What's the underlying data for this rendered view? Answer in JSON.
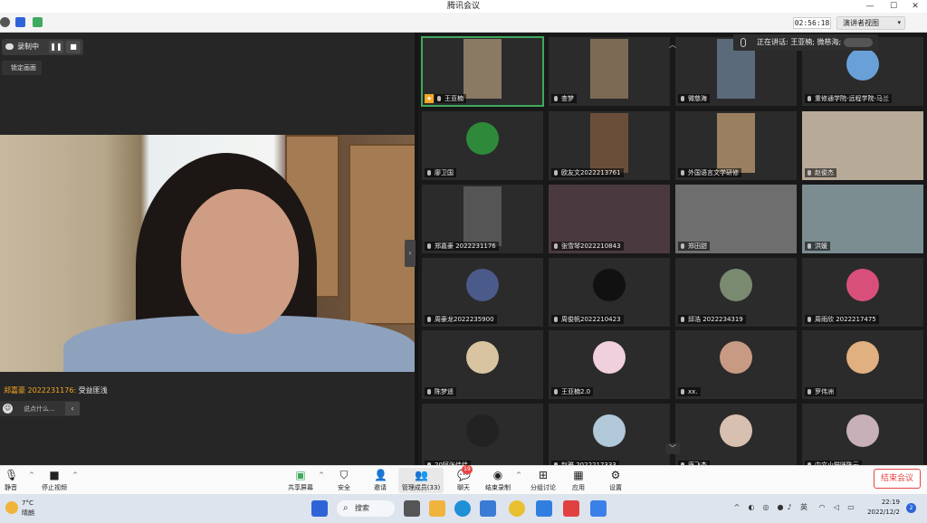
{
  "window": {
    "title": "腾讯会议",
    "min": "—",
    "max": "☐",
    "close": "✕"
  },
  "topbar": {
    "timer": "02:56:18",
    "view_label": "演讲者视图"
  },
  "main": {
    "record_label": "录制中",
    "pin_label": "锁定画面",
    "speaker_name": "郑嘉豪 2022231176:",
    "speaker_msg": "受益匪浅",
    "chat_placeholder": "说点什么..."
  },
  "speaking": {
    "label": "正在讲话: 王亚楠; 微慈海;"
  },
  "participants": [
    {
      "name": "王亚楠",
      "type": "video",
      "color": "#8a7a64"
    },
    {
      "name": "查梦",
      "type": "video",
      "color": "#7d6a55"
    },
    {
      "name": "微慈海",
      "type": "video",
      "color": "#5b6a7a"
    },
    {
      "name": "重修通学院-远程学院-马兰",
      "type": "avatar",
      "color": "#6aa0d8"
    },
    {
      "name": "廖卫国",
      "type": "avatar",
      "color": "#2e8a3a"
    },
    {
      "name": "欧友文2022213761",
      "type": "video",
      "color": "#6b4e3a"
    },
    {
      "name": "外国语言文学研修",
      "type": "video",
      "color": "#9a8060"
    },
    {
      "name": "赵俊杰",
      "type": "full",
      "color": "#b8aa98"
    },
    {
      "name": "郑嘉豪 2022231176",
      "type": "video",
      "color": "#555555"
    },
    {
      "name": "张雪琴2022210843",
      "type": "full",
      "color": "#4a3a40"
    },
    {
      "name": "郑田甜",
      "type": "full",
      "color": "#6e6e6e"
    },
    {
      "name": "洪媛",
      "type": "full",
      "color": "#7b8d90"
    },
    {
      "name": "周豪龙2022235900",
      "type": "avatar",
      "color": "#4a5a8a"
    },
    {
      "name": "周俊帆2022210423",
      "type": "avatar",
      "color": "#111111"
    },
    {
      "name": "邱浩 2022234319",
      "type": "avatar",
      "color": "#7a8a70"
    },
    {
      "name": "周雨欣 2022217475",
      "type": "avatar",
      "color": "#d8507a"
    },
    {
      "name": "陈梦遥",
      "type": "avatar",
      "color": "#d8c4a0"
    },
    {
      "name": "王亚楠2.0",
      "type": "avatar",
      "color": "#f0d0dc"
    },
    {
      "name": "xx.",
      "type": "avatar",
      "color": "#c89a84"
    },
    {
      "name": "罗伟洲",
      "type": "avatar",
      "color": "#e0b080"
    },
    {
      "name": "20阿张佳佳",
      "type": "avatar",
      "color": "#222222"
    },
    {
      "name": "赵雅 2022217333",
      "type": "avatar",
      "color": "#b0c8d8"
    },
    {
      "name": "唐飞杰",
      "type": "avatar",
      "color": "#d8c0b0"
    },
    {
      "name": "中文小猫咪陈云",
      "type": "avatar",
      "color": "#c8b0b8"
    }
  ],
  "toolbar": {
    "mute": "静音",
    "stop_video": "停止视频",
    "share": "共享屏幕",
    "security": "安全",
    "invite": "邀请",
    "members": "管理成员(33)",
    "chat": "聊天",
    "chat_badge": "19",
    "end_record": "结束录制",
    "breakout": "分组讨论",
    "apps": "应用",
    "settings": "设置",
    "end_meeting": "结束会议"
  },
  "taskbar": {
    "temperature": "7°C",
    "weather": "晴朗",
    "search": "搜索",
    "ime": "英",
    "time": "22:19",
    "date": "2022/12/2",
    "notifications": "2"
  },
  "colors": {
    "accent_green": "#3fa95e",
    "end_red": "#e64545",
    "host_orange": "#f5a623"
  }
}
